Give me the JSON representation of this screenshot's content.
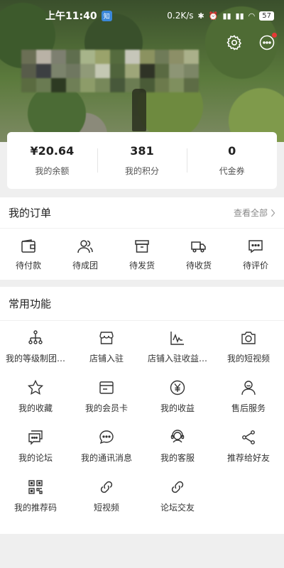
{
  "status_bar": {
    "time": "上午11:40",
    "badge": "知",
    "network_speed": "0.2K/s",
    "battery": "57"
  },
  "balance": [
    {
      "value": "¥20.64",
      "label": "我的余额"
    },
    {
      "value": "381",
      "label": "我的积分"
    },
    {
      "value": "0",
      "label": "代金券"
    }
  ],
  "orders": {
    "title": "我的订单",
    "view_all": "查看全部",
    "items": [
      {
        "label": "待付款",
        "icon": "wallet-icon"
      },
      {
        "label": "待成团",
        "icon": "group-icon"
      },
      {
        "label": "待发货",
        "icon": "box-icon"
      },
      {
        "label": "待收货",
        "icon": "truck-icon"
      },
      {
        "label": "待评价",
        "icon": "comment-icon"
      }
    ]
  },
  "functions": {
    "title": "常用功能",
    "items": [
      {
        "label": "我的等级制团…",
        "icon": "hierarchy-icon"
      },
      {
        "label": "店铺入驻",
        "icon": "store-icon"
      },
      {
        "label": "店铺入驻收益…",
        "icon": "chart-icon"
      },
      {
        "label": "我的短视频",
        "icon": "camera-icon"
      },
      {
        "label": "我的收藏",
        "icon": "star-icon"
      },
      {
        "label": "我的会员卡",
        "icon": "card-icon"
      },
      {
        "label": "我的收益",
        "icon": "yen-icon"
      },
      {
        "label": "售后服务",
        "icon": "service-person-icon"
      },
      {
        "label": "我的论坛",
        "icon": "forum-icon"
      },
      {
        "label": "我的通讯消息",
        "icon": "message-icon"
      },
      {
        "label": "我的客服",
        "icon": "headset-icon"
      },
      {
        "label": "推荐给好友",
        "icon": "share-icon"
      },
      {
        "label": "我的推荐码",
        "icon": "qrcode-icon"
      },
      {
        "label": "短视频",
        "icon": "link-icon"
      },
      {
        "label": "论坛交友",
        "icon": "link-icon"
      }
    ]
  },
  "top_icons": [
    {
      "icon": "gear-icon"
    },
    {
      "icon": "chat-icon"
    }
  ]
}
